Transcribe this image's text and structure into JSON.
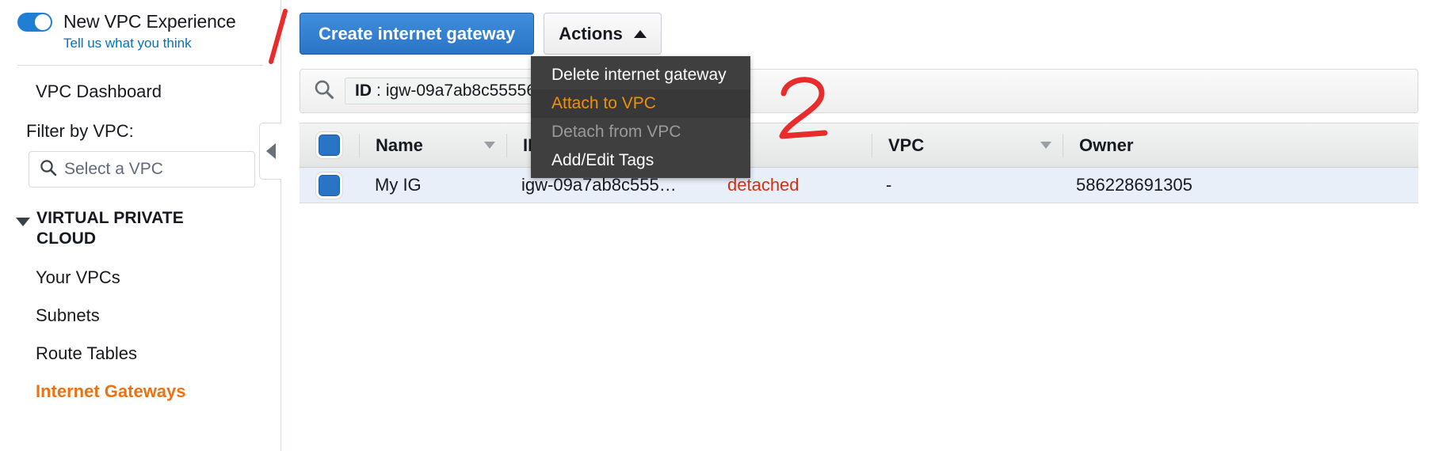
{
  "sidebar": {
    "toggle": {
      "label": "New VPC Experience",
      "state": "on",
      "feedback_link": "Tell us what you think"
    },
    "dashboard_item": "VPC Dashboard",
    "filter": {
      "label": "Filter by VPC:",
      "placeholder": "Select a VPC",
      "value": ""
    },
    "group": {
      "title": "VIRTUAL PRIVATE CLOUD",
      "expanded": true
    },
    "items": [
      {
        "label": "Your VPCs",
        "active": false
      },
      {
        "label": "Subnets",
        "active": false
      },
      {
        "label": "Route Tables",
        "active": false
      },
      {
        "label": "Internet Gateways",
        "active": true
      }
    ]
  },
  "toolbar": {
    "create_label": "Create internet gateway",
    "actions_label": "Actions",
    "actions_expanded": true
  },
  "actions_menu": {
    "items": [
      {
        "label": "Delete internet gateway",
        "state": "enabled"
      },
      {
        "label": "Attach to VPC",
        "state": "highlighted"
      },
      {
        "label": "Detach from VPC",
        "state": "disabled"
      },
      {
        "label": "Add/Edit Tags",
        "state": "enabled"
      }
    ]
  },
  "search": {
    "placeholder": "",
    "token_key": "ID",
    "token_separator": ":",
    "token_value": "igw-09a7ab8c55556..."
  },
  "table": {
    "columns": [
      {
        "key": "name",
        "label": "Name",
        "sortable": true
      },
      {
        "key": "id",
        "label": "ID",
        "sortable": false
      },
      {
        "key": "state",
        "label": "",
        "sortable": false
      },
      {
        "key": "vpc",
        "label": "VPC",
        "sortable": true
      },
      {
        "key": "owner",
        "label": "Owner",
        "sortable": false
      }
    ],
    "header_select_all": true,
    "rows": [
      {
        "selected": true,
        "name": "My IG",
        "id": "igw-09a7ab8c555…",
        "state": "detached",
        "vpc": "-",
        "owner": "586228691305"
      }
    ]
  },
  "annotations": [
    {
      "name": "step-1",
      "text": "1",
      "color": "#e82c2c"
    },
    {
      "name": "step-2",
      "text": "2",
      "color": "#e82c2c"
    }
  ],
  "colors": {
    "accent_blue": "#2a74c6",
    "active_orange": "#ec7211",
    "menu_highlight_orange": "#ec9010",
    "state_red": "#d13212",
    "annotation_red": "#e82c2c",
    "menu_bg": "#3f3f3f"
  }
}
